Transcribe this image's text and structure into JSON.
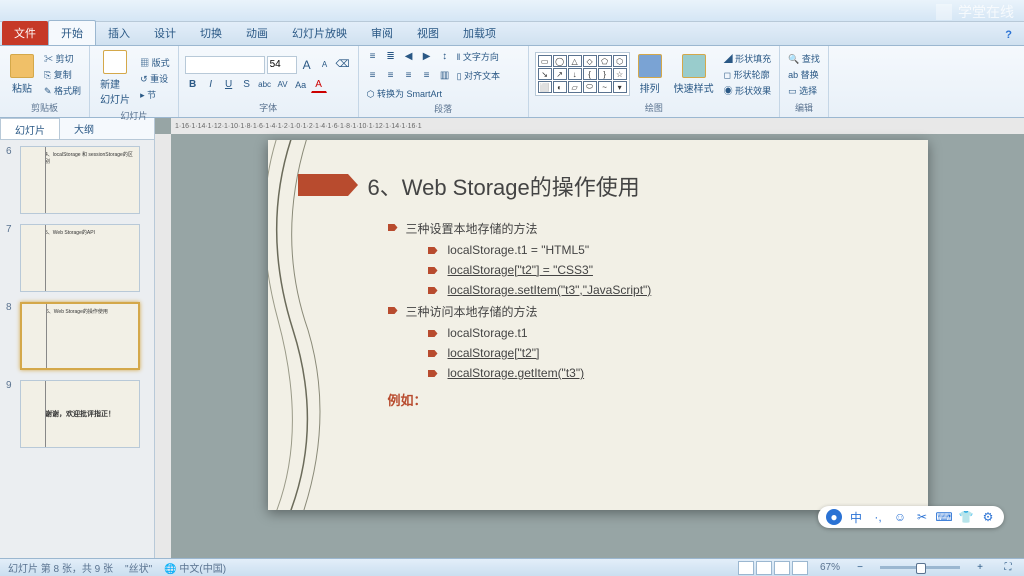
{
  "app": {
    "help_hint": "?"
  },
  "watermark": {
    "text": "学堂在线"
  },
  "tabs": {
    "file": "文件",
    "items": [
      "开始",
      "插入",
      "设计",
      "切换",
      "动画",
      "幻灯片放映",
      "审阅",
      "视图",
      "加载项"
    ],
    "active": 0
  },
  "ribbon": {
    "clipboard": {
      "title": "剪贴板",
      "paste": "粘贴",
      "cut": "剪切",
      "copy": "复制",
      "painter": "格式刷"
    },
    "slides": {
      "title": "幻灯片",
      "new": "新建\n幻灯片",
      "layout": "版式",
      "reset": "重设",
      "section": "节"
    },
    "font": {
      "title": "字体",
      "name": "",
      "size": "54",
      "grow": "A",
      "shrink": "A",
      "b": "B",
      "i": "I",
      "u": "U",
      "s": "S",
      "abc": "abc",
      "av": "AV",
      "aa": "Aa",
      "clear": "A"
    },
    "paragraph": {
      "title": "段落",
      "dir": "文字方向",
      "align": "对齐文本",
      "smart": "转换为 SmartArt"
    },
    "drawing": {
      "title": "绘图",
      "arrange": "排列",
      "quick": "快速样式",
      "fill": "形状填充",
      "outline": "形状轮廓",
      "effects": "形状效果"
    },
    "editing": {
      "title": "编辑",
      "find": "查找",
      "replace": "替换",
      "select": "选择"
    }
  },
  "leftPane": {
    "tabs": {
      "slides": "幻灯片",
      "outline": "大纲"
    },
    "thumbs": [
      {
        "num": "6",
        "title": "4、localStorage 和 sessionStorage的区别"
      },
      {
        "num": "7",
        "title": "5、Web Storage的API"
      },
      {
        "num": "8",
        "title": "6、Web Storage的操作使用",
        "selected": true
      },
      {
        "num": "9",
        "title": "谢谢，欢迎批评指正！"
      }
    ]
  },
  "slide": {
    "title": "6、Web Storage的操作使用",
    "section1": "三种设置本地存储的方法",
    "s1a": "localStorage.t1 = \"HTML5\"",
    "s1b": "localStorage[\"t2\"] = \"CSS3\"",
    "s1c": "localStorage.setItem(\"t3\",\"JavaScript\")",
    "section2": "三种访问本地存储的方法",
    "s2a": "localStorage.t1",
    "s2b": "localStorage[\"t2\"]",
    "s2c": "localStorage.getItem(\"t3\")",
    "example": "例如："
  },
  "ruler": "1·16·1·14·1·12·1·10·1·8·1·6·1·4·1·2·1·0·1·2·1·4·1·6·1·8·1·10·1·12·1·14·1·16·1",
  "status": {
    "slide_pos": "幻灯片 第 8 张，共 9 张",
    "theme": "\"丝状\"",
    "lang": "中文(中国)",
    "zoom": "67%"
  }
}
